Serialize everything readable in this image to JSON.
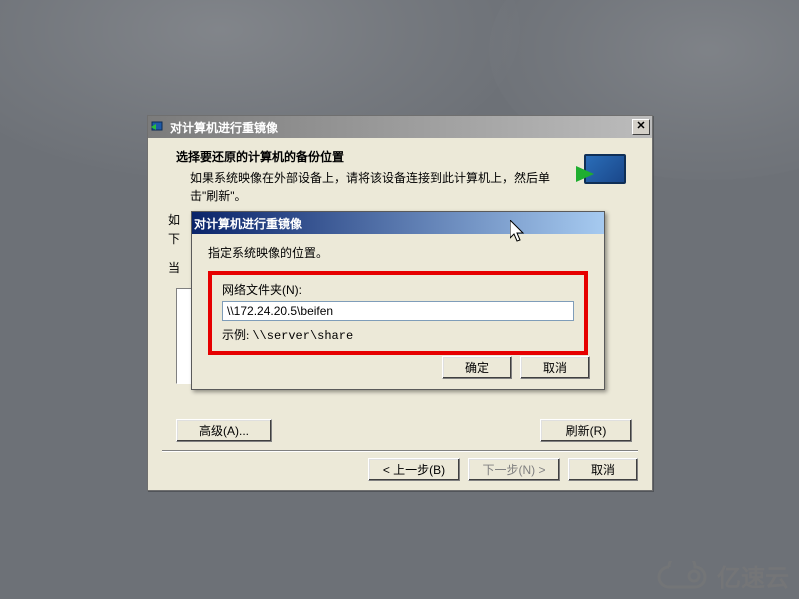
{
  "colors": {
    "highlight_border": "#e60000"
  },
  "parent": {
    "title": "对计算机进行重镜像",
    "header_title": "选择要还原的计算机的备份位置",
    "header_sub": "如果系统映像在外部设备上，请将该设备连接到此计算机上，然后单击\"刷新\"。",
    "truncated_line": "如",
    "truncated_line2": "下",
    "truncated_line3": "当",
    "buttons": {
      "advanced": "高级(A)...",
      "refresh": "刷新(R)",
      "back": "< 上一步(B)",
      "next": "下一步(N) >",
      "cancel": "取消"
    }
  },
  "child": {
    "title": "对计算机进行重镜像",
    "instruction": "指定系统映像的位置。",
    "field_label": "网络文件夹(N):",
    "field_value": "\\\\172.24.20.5\\beifen",
    "example_prefix": "示例: ",
    "example_value": "\\\\server\\share",
    "buttons": {
      "ok": "确定",
      "cancel": "取消"
    }
  },
  "watermark": {
    "text": "亿速云"
  }
}
